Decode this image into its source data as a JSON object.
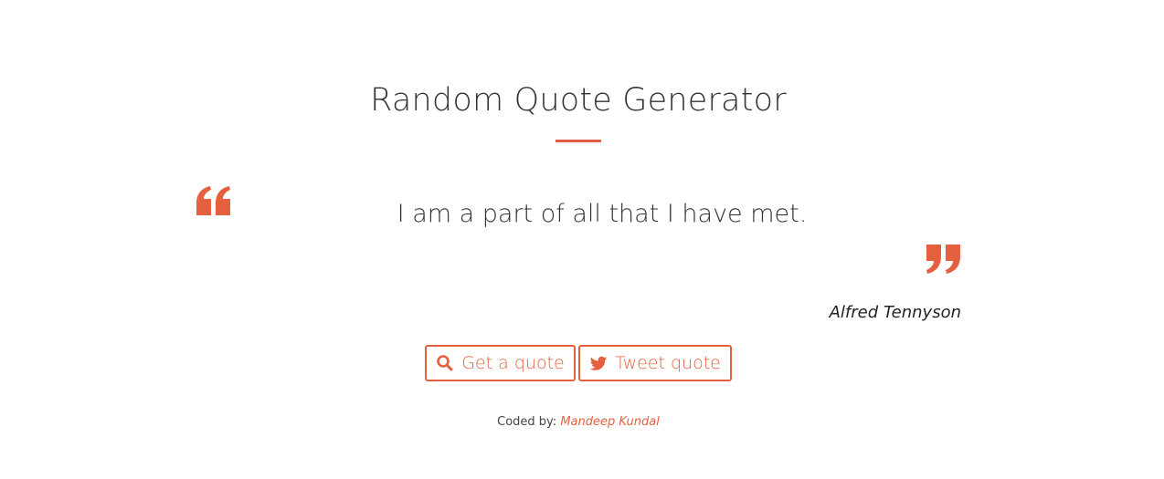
{
  "app": {
    "title": "Random Quote Generator"
  },
  "quote": {
    "text": "I am a part of all that I have met.",
    "author": "Alfred Tennyson",
    "open_icon": "quote-left-icon",
    "close_icon": "quote-right-icon"
  },
  "buttons": {
    "get_quote_label": "Get a quote",
    "get_quote_icon": "search-icon",
    "tweet_label": "Tweet quote",
    "tweet_icon": "twitter-icon"
  },
  "footer": {
    "prefix": "Coded by:",
    "author_link": "Mandeep Kundal"
  },
  "colors": {
    "accent": "#e5603e",
    "text": "#333333"
  }
}
